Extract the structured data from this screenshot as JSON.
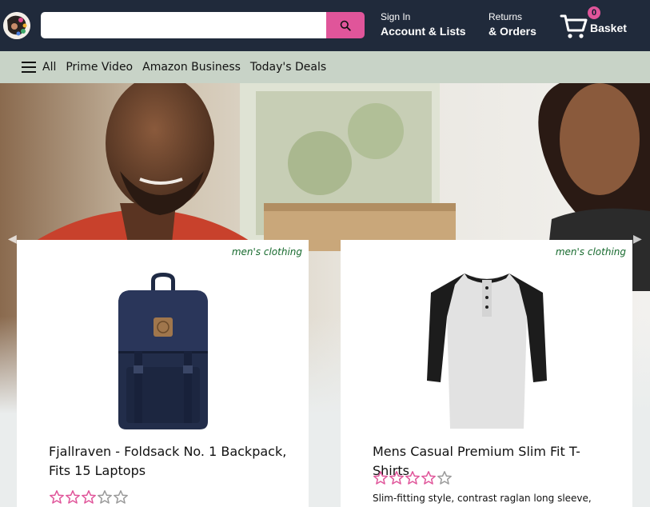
{
  "header": {
    "logo_icon": "colorful-avatar-logo",
    "search": {
      "value": "",
      "placeholder": ""
    },
    "search_icon": "search-icon",
    "sign_in": {
      "line1": "Sign In",
      "line2": "Account & Lists"
    },
    "returns": {
      "line1": "Returns",
      "line2": "& Orders"
    },
    "basket": {
      "count": "0",
      "label": "Basket",
      "icon": "cart-icon"
    },
    "accent_color": "#e0559a",
    "background_color": "#202a3b"
  },
  "nav": {
    "background_color": "#c8d3c7",
    "items": [
      {
        "label": "All",
        "icon": "hamburger-menu-icon"
      },
      {
        "label": "Prime Video"
      },
      {
        "label": "Amazon Business"
      },
      {
        "label": "Today's Deals"
      }
    ]
  },
  "products": [
    {
      "category": "men's clothing",
      "title": "Fjallraven - Foldsack No. 1 Backpack, Fits 15 Laptops",
      "rating": 3,
      "max_rating": 5,
      "image_icon": "navy-backpack-image"
    },
    {
      "category": "men's clothing",
      "title": "Mens Casual Premium Slim Fit T-Shirts",
      "rating": 4,
      "max_rating": 5,
      "description": "Slim-fitting style, contrast raglan long sleeve,",
      "image_icon": "raglan-henley-shirt-image"
    }
  ],
  "rating_color": "#e0559a"
}
